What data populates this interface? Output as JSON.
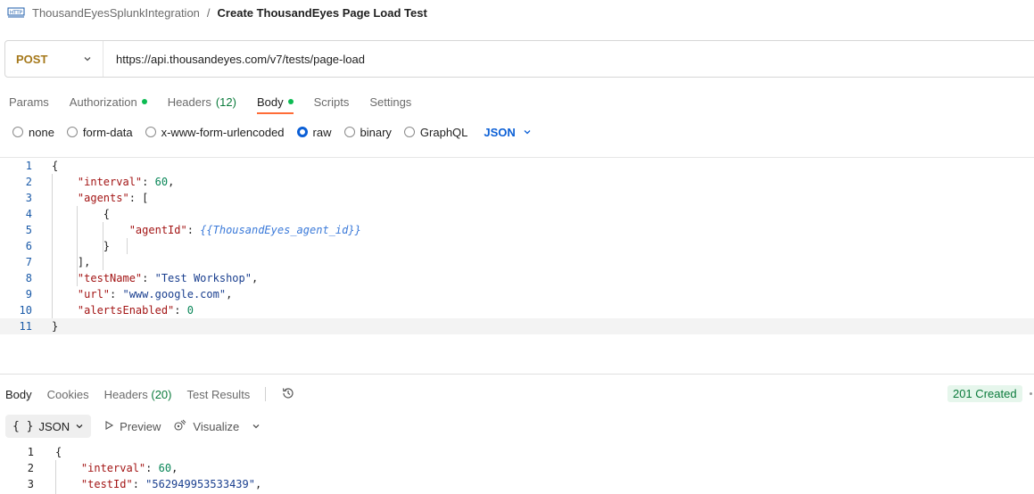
{
  "breadcrumb": {
    "icon": "http-icon",
    "parent": "ThousandEyesSplunkIntegration",
    "separator": "/",
    "current": "Create ThousandEyes Page Load Test"
  },
  "request": {
    "method": "POST",
    "url": "https://api.thousandeyes.com/v7/tests/page-load"
  },
  "tabs": {
    "params": "Params",
    "authorization": "Authorization",
    "headers": "Headers",
    "headers_count": "(12)",
    "body": "Body",
    "scripts": "Scripts",
    "settings": "Settings"
  },
  "body_types": {
    "none": "none",
    "form_data": "form-data",
    "urlencoded": "x-www-form-urlencoded",
    "raw": "raw",
    "binary": "binary",
    "graphql": "GraphQL",
    "language": "JSON"
  },
  "request_body": {
    "line_numbers": [
      "1",
      "2",
      "3",
      "4",
      "5",
      "6",
      "7",
      "8",
      "9",
      "10",
      "11"
    ],
    "open_brace": "{",
    "close_brace": "}",
    "open_bracket": "[",
    "close_bracket": "],",
    "interval_key": "\"interval\"",
    "interval_value": "60",
    "agents_key": "\"agents\"",
    "agent_id_key": "\"agentId\"",
    "agent_id_value": "{{ThousandEyes_agent_id}}",
    "test_name_key": "\"testName\"",
    "test_name_value": "\"Test Workshop\"",
    "url_key": "\"url\"",
    "url_value": "\"www.google.com\"",
    "alerts_key": "\"alertsEnabled\"",
    "alerts_value": "0"
  },
  "response": {
    "tabs": {
      "body": "Body",
      "cookies": "Cookies",
      "headers": "Headers",
      "headers_count": "(20)",
      "test_results": "Test Results"
    },
    "status": "201 Created",
    "format": "JSON",
    "preview": "Preview",
    "visualize": "Visualize",
    "line_numbers": [
      "1",
      "2",
      "3"
    ],
    "open_brace": "{",
    "interval_key": "\"interval\"",
    "interval_value": "60",
    "test_id_key": "\"testId\"",
    "test_id_value": "\"562949953533439\""
  }
}
